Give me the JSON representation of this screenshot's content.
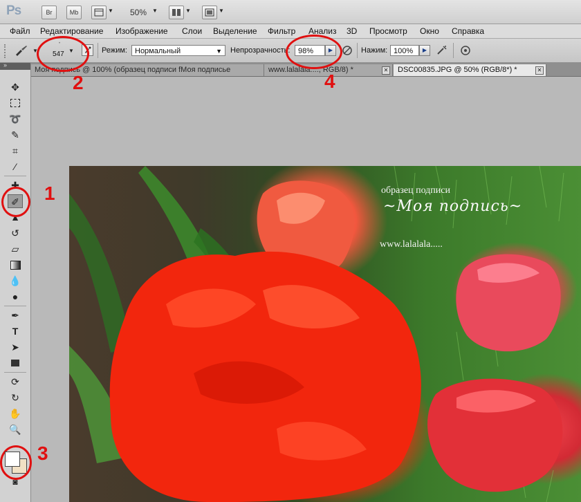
{
  "appbar": {
    "logo": "Ps",
    "bridge_label": "Br",
    "minibridge_label": "Mb",
    "zoom": "50%"
  },
  "menu": [
    "Файл",
    "Редактирование",
    "Изображение",
    "Слои",
    "Выделение",
    "Фильтр",
    "Анализ",
    "3D",
    "Просмотр",
    "Окно",
    "Справка"
  ],
  "options": {
    "brush_size": "547",
    "mode_label": "Режим:",
    "mode_value": "Нормальный",
    "opacity_label": "Непрозрачность:",
    "opacity_value": "98%",
    "flow_label": "Нажим:",
    "flow_value": "100%"
  },
  "tabs": [
    {
      "label": "Моя подпись @ 100% (образец подписи   fМоя подписье",
      "active": false
    },
    {
      "label": "www.lalalala...., RGB/8) *",
      "active": false
    },
    {
      "label": "DSC00835.JPG @ 50% (RGB/8*) *",
      "active": true
    }
  ],
  "colors": {
    "foreground": "#ffffff",
    "background": "#f1e0c4",
    "annotation": "#e01010"
  },
  "canvas": {
    "caption": "образец подписи",
    "signature": "~Моя подпись~",
    "url": "www.lalalala....."
  },
  "annotations": [
    "1",
    "2",
    "3",
    "4"
  ]
}
